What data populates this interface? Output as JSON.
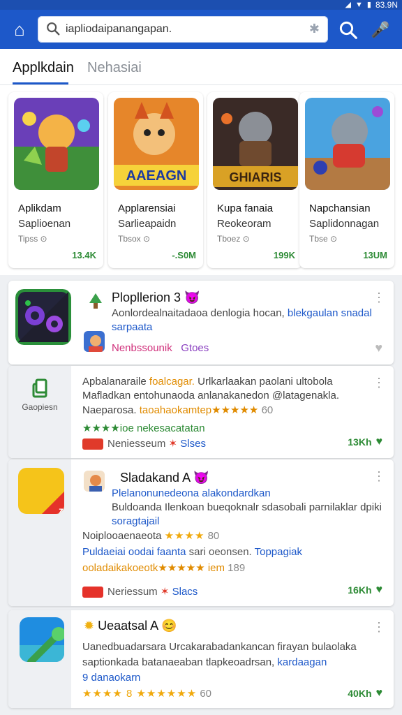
{
  "status_bar": {
    "time": "83.9N"
  },
  "search": {
    "query": "iapliodaipanangapan."
  },
  "tabs": [
    {
      "label": "Applkdain",
      "active": true
    },
    {
      "label": "Nehasiai",
      "active": false
    }
  ],
  "featured": [
    {
      "title": "Aplikdam",
      "subtitle": "Saplioenan",
      "meta": "Tipss ⊙",
      "size": "13.4K",
      "art_text": ""
    },
    {
      "title": "Applarensiai",
      "subtitle": "Sarlieapaidn",
      "meta": "Tbsox ⊙",
      "size": "-.S0M",
      "art_text": "AAEAGN"
    },
    {
      "title": "Kupa fanaia",
      "subtitle": "Reokeoram",
      "meta": "Tboez ⊙",
      "size": "199K",
      "art_text": "GHIARIS"
    },
    {
      "title": "Napchansian",
      "subtitle": "Saplidonnagan",
      "meta": "Tbse ⊙",
      "size": "13UM",
      "art_text": ""
    }
  ],
  "list": [
    {
      "title": "Plopllerion 3",
      "title_emoji": "😈",
      "desc_line1": "Aonlordealnaitadaoa denlogia hocan,",
      "desc_line1_blue": "blekgaulan snadal",
      "desc_line2": "sarpaata",
      "tag_pink": "Nenbssounik",
      "tag_purple": "Gtoes"
    },
    {
      "side_label": "Gaopiesn",
      "line1": "Apbalanaraile",
      "line1_orange": "foalcagar.",
      "line1_rest": "Urlkarlaakan paolani ultobola",
      "line2": "Mafladkan entohunaoda anlanakanedon @latagenakla.",
      "line3": "Naeparosa.",
      "line3_orange": "taoahaokamtep★★★★★",
      "line3_rating": "60",
      "line4_green": "★★★★ioe nekesacatatan",
      "tag_text": "Neniesseum",
      "tag_blue": "Slses",
      "size": "13Kh"
    },
    {
      "title": "Sladakand A",
      "title_emoji": "😈",
      "line1_blue": "Plelanonunedeona alakondardkan",
      "line2": "Buldoanda Ilenkoan bueqoknalr sdasobali parnilaklar dpiki",
      "line3_blue": "soragtajail",
      "line4": "Noiplooaenaeota",
      "line4_rating": "★★★★",
      "line4_score": "80",
      "line5_blue": "Puldaeiai oodai faanta",
      "line5_gray": "sari oeonsen.",
      "line5_blue2": "Toppagiak",
      "line6_orange": "ooladaikakoeotk★★★★★ iem",
      "line6_score": "189",
      "tag_text": "Neriessum",
      "tag_blue": "Slacs",
      "size": "16Kh"
    },
    {
      "title": "Ueaatsal A",
      "title_emoji": "😊",
      "line1": "Uanedbuadarsara Urcakarabadankancan firayan bulaolaka",
      "line2": "saptionkada batanaeaban tlapkeoadrsan,",
      "line2_blue": "kardaagan",
      "line3_blue": "9 danaokarn",
      "line4_stars": "★★★★ 8 ★★★★★★",
      "line4_score": "60",
      "size": "40Kh"
    }
  ]
}
